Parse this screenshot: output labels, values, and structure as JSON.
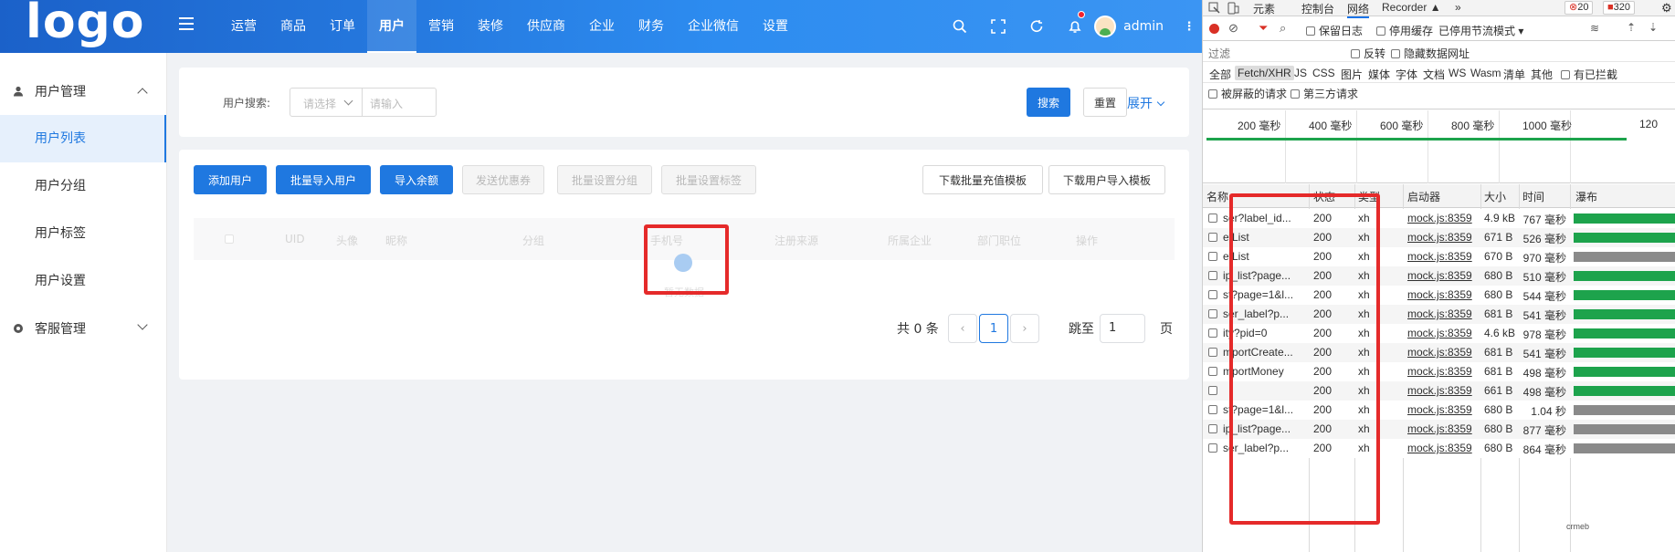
{
  "app": {
    "logo": "logo",
    "nav": [
      "运营",
      "商品",
      "订单",
      "用户",
      "营销",
      "装修",
      "供应商",
      "企业",
      "财务",
      "企业微信",
      "设置"
    ],
    "nav_active": "用户",
    "user_name": "admin"
  },
  "sidebar": {
    "groups": [
      {
        "label": "用户管理",
        "expanded": true,
        "items": [
          "用户列表",
          "用户分组",
          "用户标签",
          "用户设置"
        ]
      },
      {
        "label": "客服管理",
        "expanded": false
      }
    ],
    "active_item": "用户列表"
  },
  "search": {
    "label": "用户搜索:",
    "select_placeholder": "请选择",
    "input_placeholder": "请输入",
    "search_btn": "搜索",
    "reset_btn": "重置",
    "expand_link": "展开"
  },
  "actions": {
    "add_user": "添加用户",
    "batch_import": "批量导入用户",
    "import_balance": "导入余额",
    "send_coupon": "发送优惠券",
    "batch_group": "批量设置分组",
    "batch_tag": "批量设置标签",
    "download_recharge": "下载批量充值模板",
    "download_import": "下载用户导入模板"
  },
  "table": {
    "columns": [
      "UID",
      "头像",
      "昵称",
      "分组",
      "手机号",
      "注册来源",
      "所属企业",
      "部门职位",
      "操作"
    ],
    "empty_text": "暂无数据"
  },
  "pagination": {
    "total_text": "共 0 条",
    "current_page": "1",
    "jump_label": "跳至",
    "jump_value": "1",
    "page_suffix": "页"
  },
  "devtools": {
    "tabs": [
      "元素",
      "控制台",
      "网络",
      "Recorder ▲",
      "»"
    ],
    "active_tab": "网络",
    "error_count": "20",
    "issue_count": "320",
    "toolbar": {
      "preserve_log": "保留日志",
      "disable_cache": "停用缓存",
      "throttle": "已停用节流模式"
    },
    "filter": {
      "placeholder": "过滤",
      "invert": "反转",
      "hide_data_urls": "隐藏数据网址"
    },
    "types": [
      "全部",
      "Fetch/XHR",
      "JS",
      "CSS",
      "图片",
      "媒体",
      "字体",
      "文档",
      "WS",
      "Wasm",
      "清单",
      "其他"
    ],
    "active_type": "Fetch/XHR",
    "blocked_cookies": "有已拦截",
    "blocked_requests": "被屏蔽的请求",
    "third_party": "第三方请求",
    "timeline_ticks": [
      "200 毫秒",
      "400 毫秒",
      "600 毫秒",
      "800 毫秒",
      "1000 毫秒",
      "120"
    ],
    "grid_headers": [
      "名称",
      "状态",
      "类型",
      "启动器",
      "大小",
      "时间",
      "瀑布"
    ],
    "rows": [
      {
        "name": "ser?label_id...",
        "status": "200",
        "type": "xh",
        "initiator": "mock.js:8359",
        "size": "4.9 kB",
        "time": "767 毫秒",
        "wf_color": "#1da34c"
      },
      {
        "name": "etList",
        "status": "200",
        "type": "xh",
        "initiator": "mock.js:8359",
        "size": "671 B",
        "time": "526 毫秒",
        "wf_color": "#1da34c"
      },
      {
        "name": "etList",
        "status": "200",
        "type": "xh",
        "initiator": "mock.js:8359",
        "size": "670 B",
        "time": "970 毫秒",
        "wf_color": "#8a8a8a"
      },
      {
        "name": "ip_list?page...",
        "status": "200",
        "type": "xh",
        "initiator": "mock.js:8359",
        "size": "680 B",
        "time": "510 毫秒",
        "wf_color": "#1da34c"
      },
      {
        "name": "st?page=1&l...",
        "status": "200",
        "type": "xh",
        "initiator": "mock.js:8359",
        "size": "680 B",
        "time": "544 毫秒",
        "wf_color": "#1da34c"
      },
      {
        "name": "ser_label?p...",
        "status": "200",
        "type": "xh",
        "initiator": "mock.js:8359",
        "size": "681 B",
        "time": "541 毫秒",
        "wf_color": "#1da34c"
      },
      {
        "name": "ity?pid=0",
        "status": "200",
        "type": "xh",
        "initiator": "mock.js:8359",
        "size": "4.6 kB",
        "time": "978 毫秒",
        "wf_color": "#1da34c"
      },
      {
        "name": "mportCreate...",
        "status": "200",
        "type": "xh",
        "initiator": "mock.js:8359",
        "size": "681 B",
        "time": "541 毫秒",
        "wf_color": "#1da34c"
      },
      {
        "name": "mportMoney",
        "status": "200",
        "type": "xh",
        "initiator": "mock.js:8359",
        "size": "681 B",
        "time": "498 毫秒",
        "wf_color": "#1da34c"
      },
      {
        "name": "",
        "status": "200",
        "type": "xh",
        "initiator": "mock.js:8359",
        "size": "661 B",
        "time": "498 毫秒",
        "wf_color": "#1da34c"
      },
      {
        "name": "st?page=1&l...",
        "status": "200",
        "type": "xh",
        "initiator": "mock.js:8359",
        "size": "680 B",
        "time": "1.04 秒",
        "wf_color": "#8a8a8a"
      },
      {
        "name": "ip_list?page...",
        "status": "200",
        "type": "xh",
        "initiator": "mock.js:8359",
        "size": "680 B",
        "time": "877 毫秒",
        "wf_color": "#8a8a8a"
      },
      {
        "name": "ser_label?p...",
        "status": "200",
        "type": "xh",
        "initiator": "mock.js:8359",
        "size": "680 B",
        "time": "864 毫秒",
        "wf_color": "#8a8a8a"
      }
    ],
    "watermark": "crmeb"
  }
}
